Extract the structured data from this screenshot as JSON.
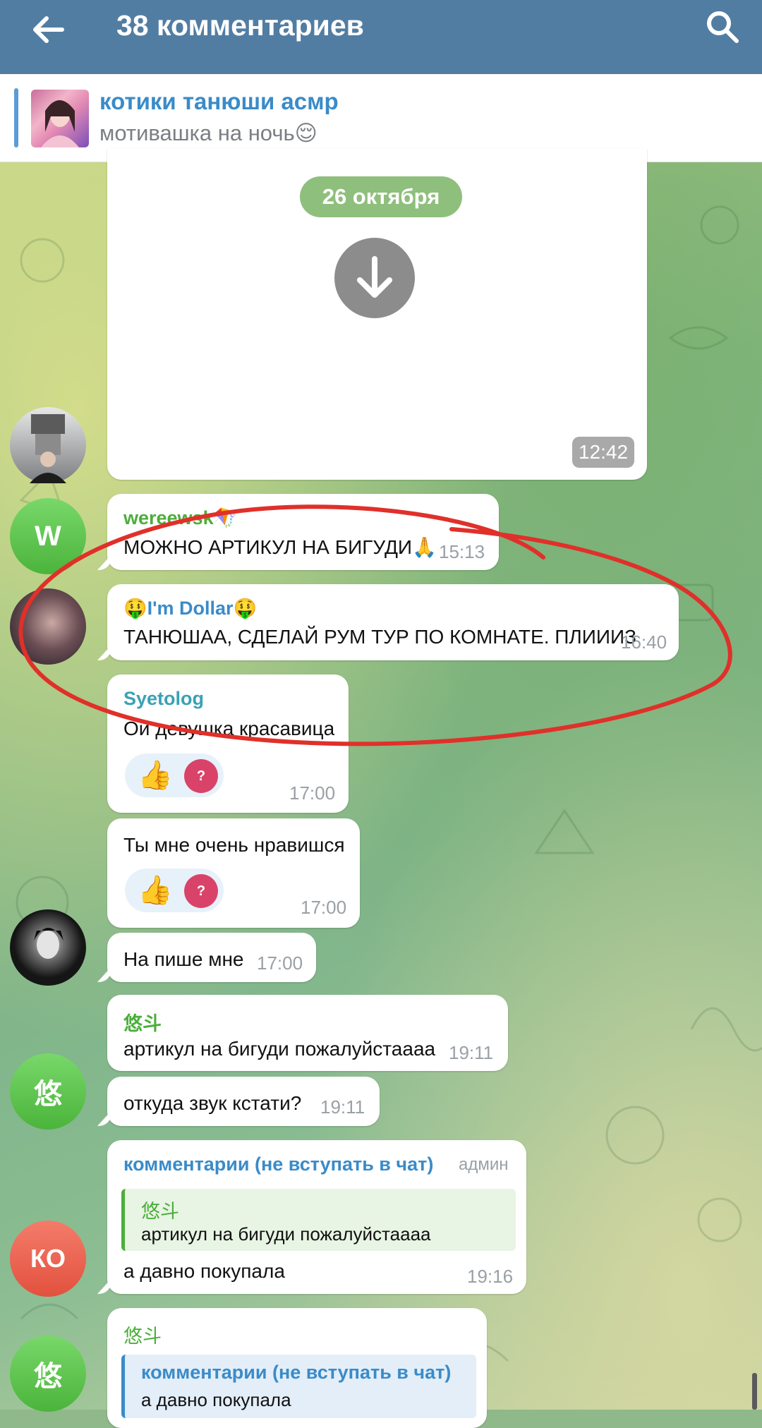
{
  "appbar": {
    "title": "38 комментариев",
    "back_icon": "arrow-left-icon",
    "search_icon": "search-icon"
  },
  "pinned": {
    "title": "котики танюши асмр",
    "subtitle": "мотивашка на ночь😌"
  },
  "media_post": {
    "date": "26 октября",
    "time": "12:42",
    "download_icon": "arrow-down-icon"
  },
  "messages": [
    {
      "sender": "wereewsk🪁",
      "text": "МОЖНО АРТИКУЛ НА БИГУДИ🙏",
      "time": "15:13",
      "avatar_letter": "W"
    },
    {
      "sender": "🤑I'm Dollar🤑",
      "text": "ТАНЮШАА, СДЕЛАЙ РУМ ТУР ПО КОМНАТЕ. ПЛИИИЗ",
      "time": "16:40"
    },
    {
      "sender": "Syetolog",
      "text": "Ой девушка красавица",
      "time": "17:00"
    },
    {
      "text": "Ты мне очень нравишся",
      "time": "17:00"
    },
    {
      "text": "На пише мне",
      "time": "17:00"
    },
    {
      "sender": "悠斗",
      "text": "артикул на бигуди пожалуйстаааа",
      "time": "19:11"
    },
    {
      "text": "откуда звук кстати?",
      "time": "19:11",
      "avatar_letter": "悠"
    },
    {
      "sender": "комментарии (не вступать в чат)",
      "badge": "админ",
      "reply_sender": "悠斗",
      "reply_text": "артикул на бигуди пожалуйстаааа",
      "text": "а давно покупала",
      "time": "19:16",
      "avatar_letter": "КО"
    },
    {
      "sender": "悠斗",
      "reply_sender": "комментарии (не вступать в чат)",
      "reply_text": "а давно покупала",
      "avatar_letter": "悠"
    }
  ],
  "reactions": {
    "emoji": "👍",
    "user_badge": "?"
  },
  "colors": {
    "appbar": "#527da3",
    "link_blue": "#3a8bc9",
    "green_name": "#4cae3b",
    "teal_name": "#3aa1b5",
    "annotation_red": "#e0302a"
  }
}
